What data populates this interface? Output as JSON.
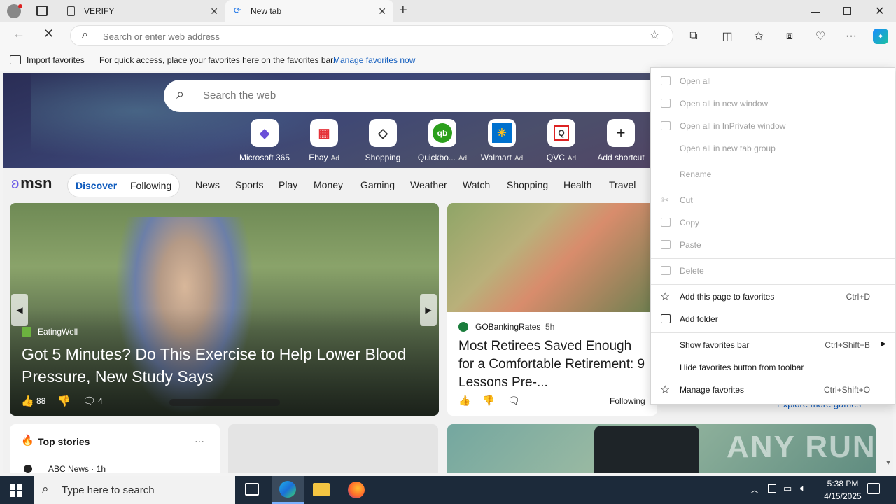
{
  "tabs": [
    {
      "title": "VERIFY"
    },
    {
      "title": "New tab"
    }
  ],
  "address": {
    "placeholder": "Search or enter web address"
  },
  "favbar": {
    "import": "Import favorites",
    "hint": "For quick access, place your favorites here on the favorites bar.",
    "manage_link": "Manage favorites now"
  },
  "search": {
    "placeholder": "Search the web"
  },
  "quicklinks": [
    {
      "label": "Microsoft 365",
      "ad": "",
      "icon": "ms365-icon"
    },
    {
      "label": "Ebay",
      "ad": "Ad",
      "icon": "ebay-icon"
    },
    {
      "label": "Shopping",
      "ad": "",
      "icon": "tag-icon"
    },
    {
      "label": "Quickbo...",
      "ad": "Ad",
      "icon": "quickbooks-icon"
    },
    {
      "label": "Walmart",
      "ad": "Ad",
      "icon": "walmart-icon"
    },
    {
      "label": "QVC",
      "ad": "Ad",
      "icon": "qvc-icon"
    },
    {
      "label": "Add shortcut",
      "ad": "",
      "icon": "plus-icon"
    }
  ],
  "msn": {
    "logo": "msn",
    "pills": [
      "Discover",
      "Following"
    ],
    "nav": [
      "News",
      "Sports",
      "Play",
      "Money",
      "Gaming",
      "Weather",
      "Watch",
      "Shopping",
      "Health",
      "Travel"
    ]
  },
  "hero_story": {
    "source": "EatingWell",
    "headline": "Got 5 Minutes? Do This Exercise to Help Lower Blood Pressure, New Study Says",
    "likes": "88",
    "comments": "4"
  },
  "side_story": {
    "source": "GOBankingRates",
    "age": "5h",
    "headline": "Most Retirees Saved Enough for a Comfortable Retirement: 9 Lessons Pre-...",
    "following": "Following"
  },
  "top_stories": {
    "title": "Top stories",
    "more": "···",
    "first_source": "ABC News · 1h"
  },
  "games_link": "Explore more games",
  "watermark": "ANY RUN",
  "context_menu": {
    "groups": [
      [
        {
          "label": "Open all",
          "shortcut": "",
          "disabled": true
        },
        {
          "label": "Open all in new window",
          "shortcut": "",
          "disabled": true
        },
        {
          "label": "Open all in InPrivate window",
          "shortcut": "",
          "disabled": true
        },
        {
          "label": "Open all in new tab group",
          "shortcut": "",
          "disabled": true
        }
      ],
      [
        {
          "label": "Rename",
          "shortcut": "",
          "disabled": true
        }
      ],
      [
        {
          "label": "Cut",
          "shortcut": "",
          "disabled": true
        },
        {
          "label": "Copy",
          "shortcut": "",
          "disabled": true
        },
        {
          "label": "Paste",
          "shortcut": "",
          "disabled": true
        }
      ],
      [
        {
          "label": "Delete",
          "shortcut": "",
          "disabled": true
        }
      ],
      [
        {
          "label": "Add this page to favorites",
          "shortcut": "Ctrl+D",
          "disabled": false
        },
        {
          "label": "Add folder",
          "shortcut": "",
          "disabled": false
        }
      ],
      [
        {
          "label": "Show favorites bar",
          "shortcut": "Ctrl+Shift+B",
          "disabled": false,
          "submenu": true
        },
        {
          "label": "Hide favorites button from toolbar",
          "shortcut": "",
          "disabled": false
        },
        {
          "label": "Manage favorites",
          "shortcut": "Ctrl+Shift+O",
          "disabled": false
        }
      ]
    ]
  },
  "taskbar": {
    "search_placeholder": "Type here to search",
    "time": "5:38 PM",
    "date": "4/15/2025"
  }
}
